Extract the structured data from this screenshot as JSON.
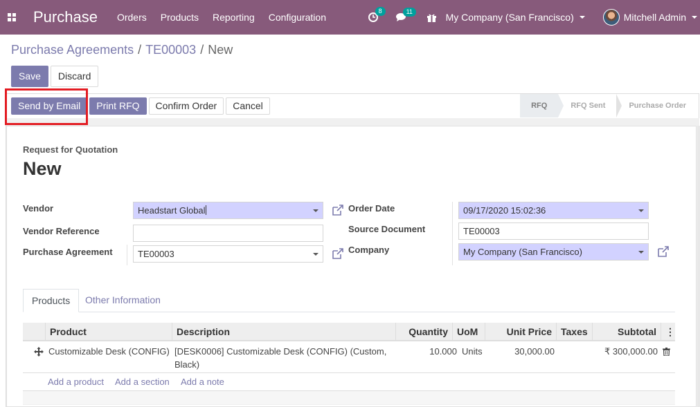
{
  "navbar": {
    "app_title": "Purchase",
    "menu": [
      "Orders",
      "Products",
      "Reporting",
      "Configuration"
    ],
    "activity_badge": "8",
    "messages_badge": "11",
    "company": "My Company (San Francisco)",
    "user": "Mitchell Admin",
    "accent": "#875a7b"
  },
  "breadcrumb": {
    "parent": "Purchase Agreements",
    "middle": "TE00003",
    "current": "New"
  },
  "control": {
    "save": "Save",
    "discard": "Discard"
  },
  "statusbar": {
    "buttons": [
      "Send by Email",
      "Print RFQ",
      "Confirm Order",
      "Cancel"
    ],
    "steps": [
      "RFQ",
      "RFQ Sent",
      "Purchase Order"
    ],
    "current_step": "RFQ"
  },
  "form": {
    "title_label": "Request for Quotation",
    "record_name": "New",
    "vendor_label": "Vendor",
    "vendor_value": "Headstart Global",
    "vendor_ref_label": "Vendor Reference",
    "vendor_ref_value": "",
    "agreement_label": "Purchase Agreement",
    "agreement_value": "TE00003",
    "order_date_label": "Order Date",
    "order_date_value": "09/17/2020 15:02:36",
    "source_doc_label": "Source Document",
    "source_doc_value": "TE00003",
    "company_label": "Company",
    "company_value": "My Company (San Francisco)"
  },
  "tabs": [
    "Products",
    "Other Information"
  ],
  "table": {
    "headers": [
      "Product",
      "Description",
      "Quantity",
      "UoM",
      "Unit Price",
      "Taxes",
      "Subtotal"
    ],
    "rows": [
      {
        "product": "Customizable Desk (CONFIG)",
        "description": "[DESK0006] Customizable Desk (CONFIG) (Custom, Black)",
        "quantity": "10.000",
        "uom": "Units",
        "unit_price": "30,000.00",
        "taxes": "",
        "subtotal": "₹ 300,000.00"
      }
    ],
    "add_links": [
      "Add a product",
      "Add a section",
      "Add a note"
    ]
  }
}
